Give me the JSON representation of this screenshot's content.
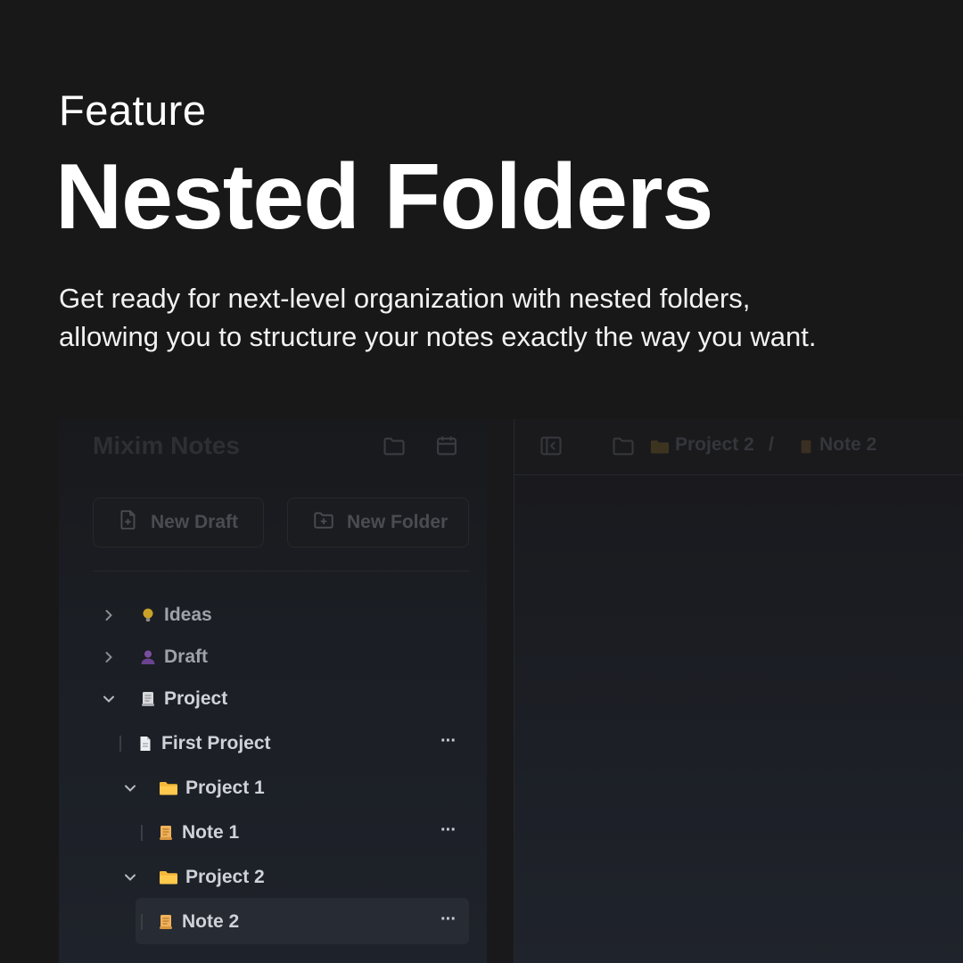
{
  "hero": {
    "eyebrow": "Feature",
    "title": "Nested Folders",
    "description_line1": "Get ready for next-level organization with nested folders,",
    "description_line2": "allowing you to structure your notes exactly the way you want."
  },
  "app": {
    "title": "Mixim Notes",
    "toolbar_icons": [
      "folder-icon",
      "calendar-icon"
    ],
    "new_draft_label": "New Draft",
    "new_folder_label": "New Folder",
    "breadcrumb": {
      "sidebar_toggle_icon": "sidebar-collapse-icon",
      "root_icon": "folder-icon",
      "folder_label": "Project 2",
      "separator": "/",
      "note_label": "Note 2"
    },
    "tree": [
      {
        "label": "Ideas",
        "icon": "lightbulb-icon",
        "state": "collapsed"
      },
      {
        "label": "Draft",
        "icon": "person-icon",
        "state": "collapsed"
      },
      {
        "label": "Project",
        "icon": "scroll-icon",
        "state": "expanded"
      },
      {
        "label": "First Project",
        "icon": "document-icon",
        "more": "···"
      },
      {
        "label": "Project 1",
        "icon": "folder-icon",
        "state": "expanded"
      },
      {
        "label": "Note 1",
        "icon": "note-icon",
        "more": "···"
      },
      {
        "label": "Project 2",
        "icon": "folder-icon",
        "state": "expanded"
      },
      {
        "label": "Note 2",
        "icon": "note-icon",
        "more": "···",
        "selected": true
      }
    ],
    "colors": {
      "folder": "#f5b93a",
      "idea": "#c9a227",
      "draft_person": "#7a4fa0",
      "selection": "#272b33"
    }
  }
}
